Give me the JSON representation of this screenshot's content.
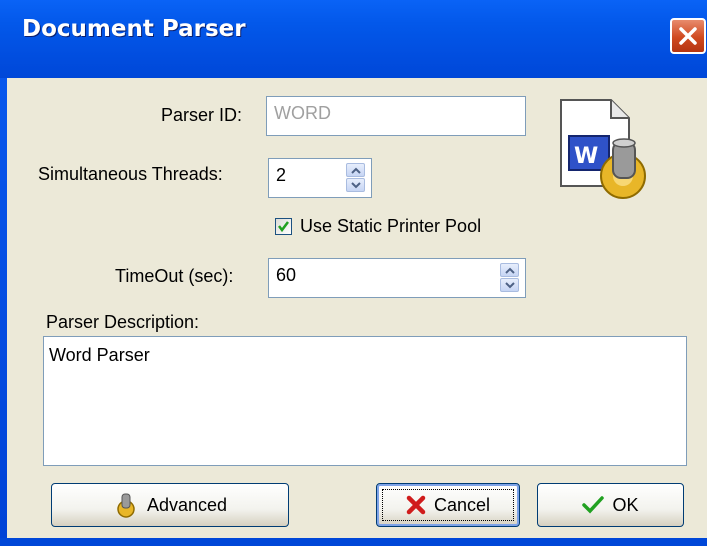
{
  "window": {
    "title": "Document Parser"
  },
  "form": {
    "parser_id_label": "Parser ID:",
    "parser_id_value": "WORD",
    "threads_label": "Simultaneous Threads:",
    "threads_value": "2",
    "static_pool_label": "Use Static Printer Pool",
    "static_pool_checked": true,
    "timeout_label": "TimeOut (sec):",
    "timeout_value": "60",
    "description_label": "Parser Description:",
    "description_value": "Word Parser"
  },
  "buttons": {
    "advanced_label": "Advanced",
    "cancel_label": "Cancel",
    "ok_label": "OK"
  },
  "icons": {
    "main": "word-parser-icon",
    "advanced": "gear-icon",
    "cancel": "red-x-icon",
    "ok": "green-check-icon"
  },
  "colors": {
    "titlebar": "#0a5bf0",
    "client_bg": "#ece9d8",
    "close_button": "#d0491f",
    "input_border": "#7f9db9"
  }
}
